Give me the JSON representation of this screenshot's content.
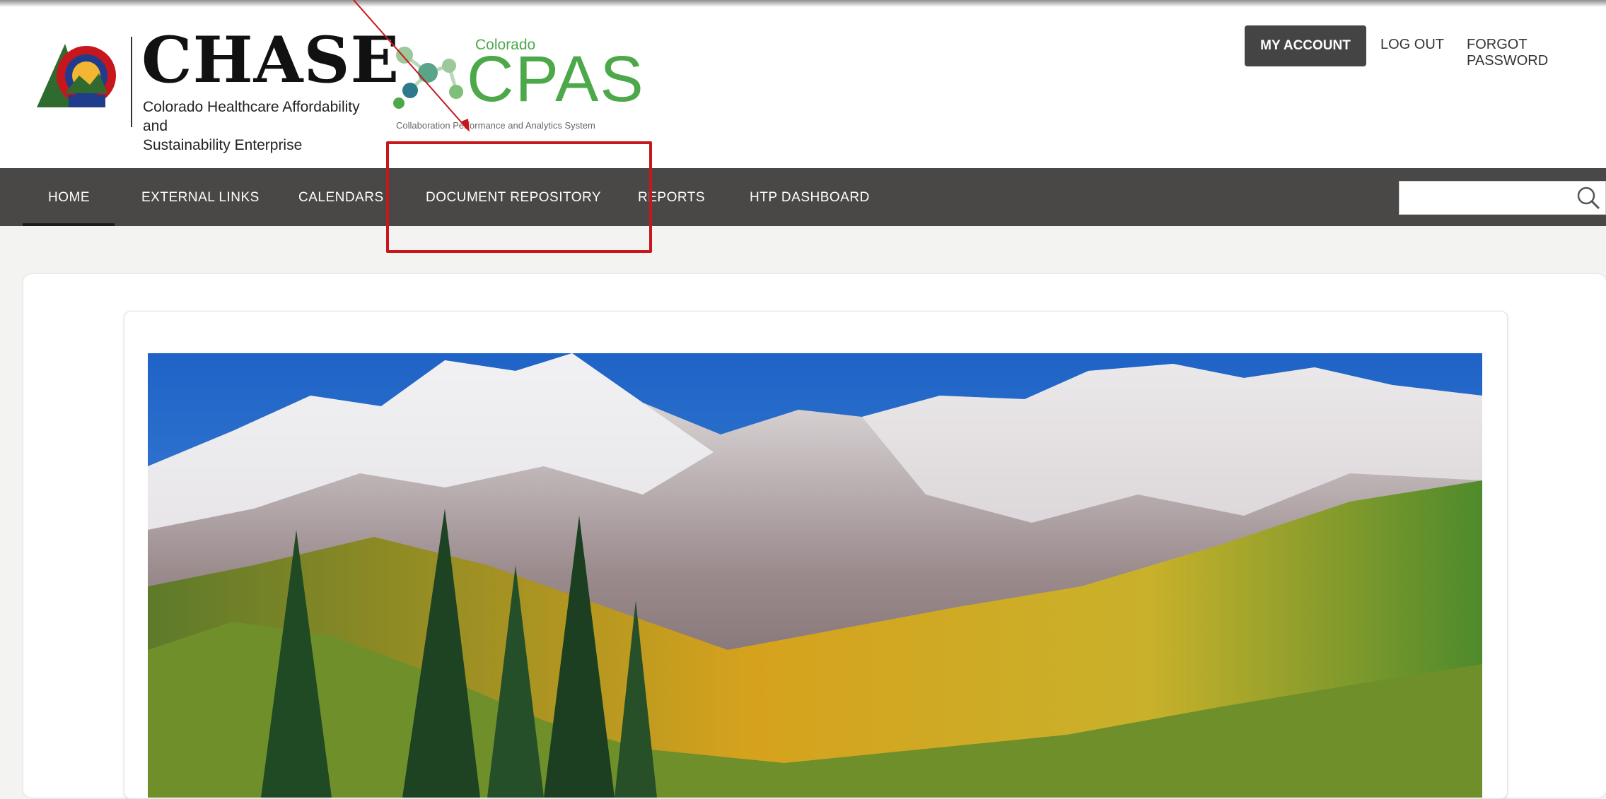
{
  "header": {
    "chase": {
      "name": "CHASE",
      "tagline_line1": "Colorado Healthcare Affordability and",
      "tagline_line2": "Sustainability Enterprise"
    },
    "cpas": {
      "state": "Colorado",
      "name": "CPAS",
      "tagline": "Collaboration Performance and Analytics System"
    },
    "account": {
      "my_account": "MY ACCOUNT",
      "log_out": "LOG OUT",
      "forgot_password": "FORGOT PASSWORD"
    }
  },
  "nav": {
    "items": [
      "HOME",
      "EXTERNAL LINKS",
      "CALENDARS",
      "DOCUMENT REPOSITORY",
      "REPORTS",
      "HTP DASHBOARD"
    ],
    "search": {
      "value": "",
      "placeholder": ""
    }
  },
  "colors": {
    "nav_bg": "#4a4846",
    "account_bg": "#444444",
    "cpas_green": "#4da84a",
    "annotation_red": "#c8161d"
  },
  "icons": {
    "search": "search-icon",
    "chase_logo": "colorado-flag-logo",
    "cpas_logo": "molecule-logo"
  }
}
